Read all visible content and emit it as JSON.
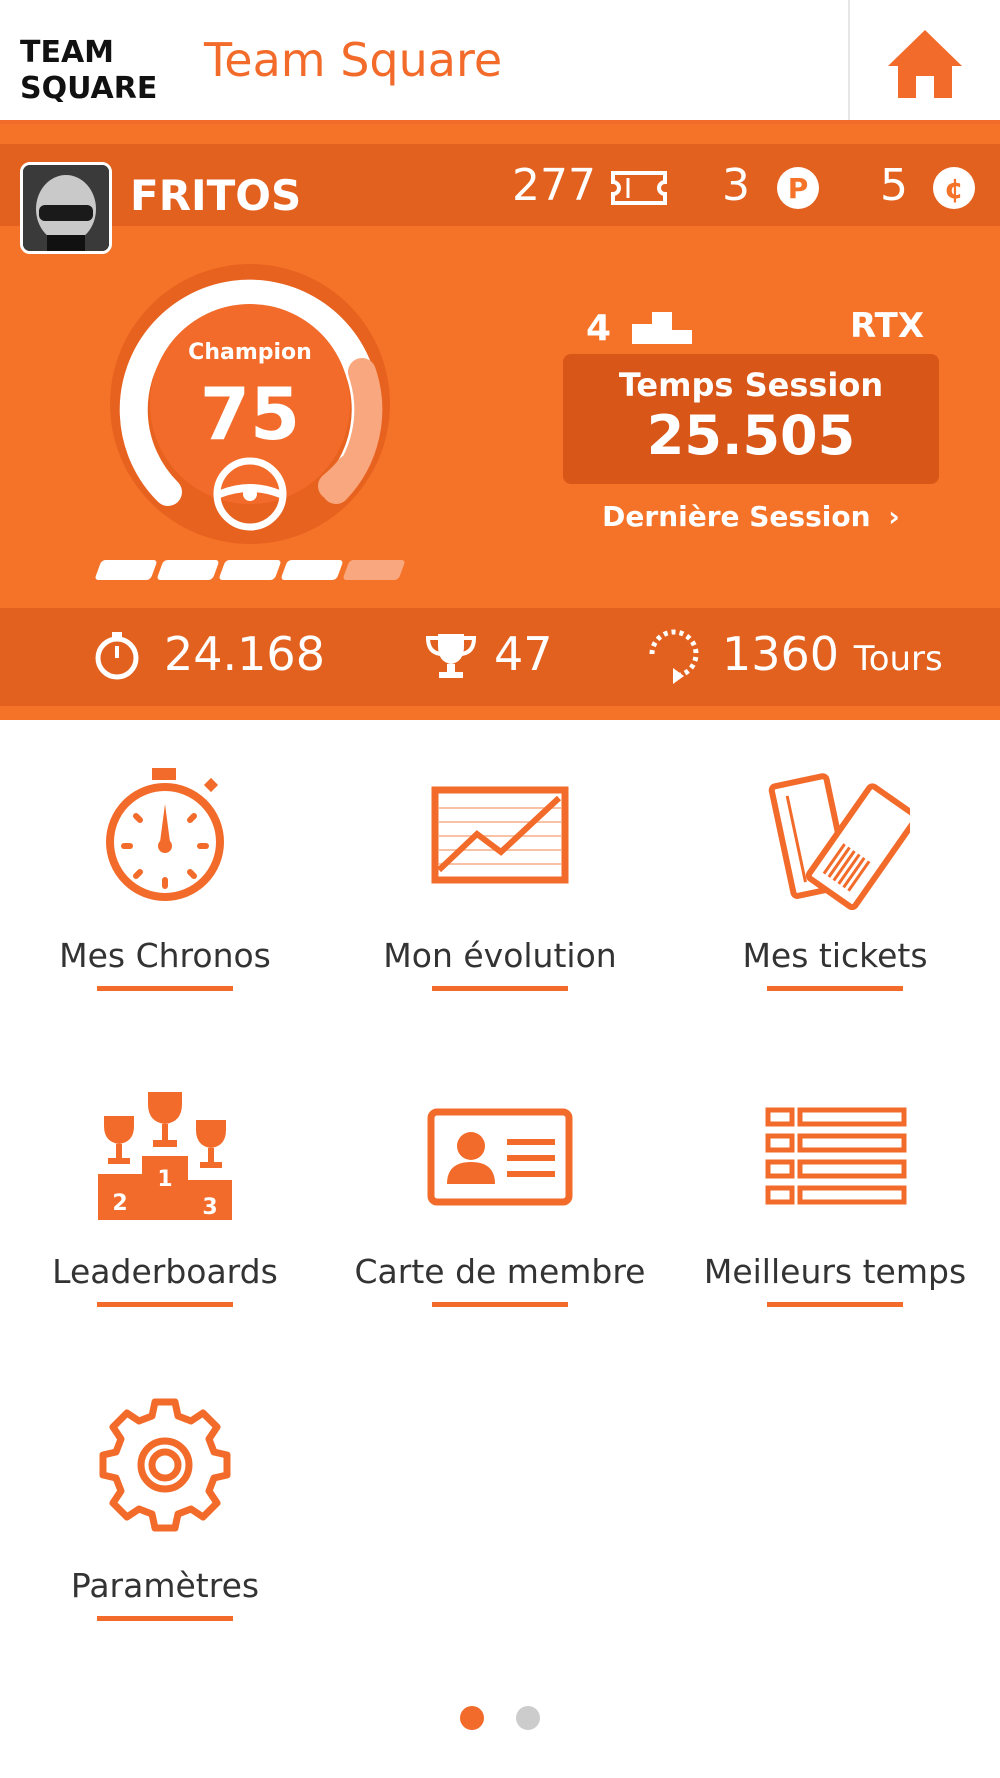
{
  "header": {
    "logo_top": "TEAM",
    "logo_bottom": "SQUARE",
    "title": "Team Square",
    "home_icon": "home-icon"
  },
  "profile": {
    "username": "FRITOS",
    "tickets": "277",
    "points": "3",
    "credits": "5",
    "level_label": "Champion",
    "level_value": "75",
    "level_segments_filled": 4,
    "level_segments_total": 5,
    "gauge_fill_fraction": 0.8,
    "rank": "4",
    "kart": "RTX",
    "session_label": "Temps Session",
    "session_time": "25.505",
    "last_session_link": "Dernière Session",
    "best_time": "24.168",
    "trophies": "47",
    "laps_value": "1360",
    "laps_unit": "Tours"
  },
  "menu": [
    {
      "label": "Mes Chronos",
      "icon": "stopwatch-icon"
    },
    {
      "label": "Mon évolution",
      "icon": "line-chart-icon"
    },
    {
      "label": "Mes tickets",
      "icon": "tickets-icon"
    },
    {
      "label": "Leaderboards",
      "icon": "podium-trophies-icon"
    },
    {
      "label": "Carte de membre",
      "icon": "member-card-icon"
    },
    {
      "label": "Meilleurs temps",
      "icon": "list-icon"
    },
    {
      "label": "Paramètres",
      "icon": "gear-icon"
    }
  ],
  "pagination": {
    "current": 1,
    "total": 2
  },
  "colors": {
    "accent": "#f26b2a",
    "profile_bg": "#f57328",
    "profile_dark": "#e3611f",
    "dot_inactive": "#cccccc"
  }
}
